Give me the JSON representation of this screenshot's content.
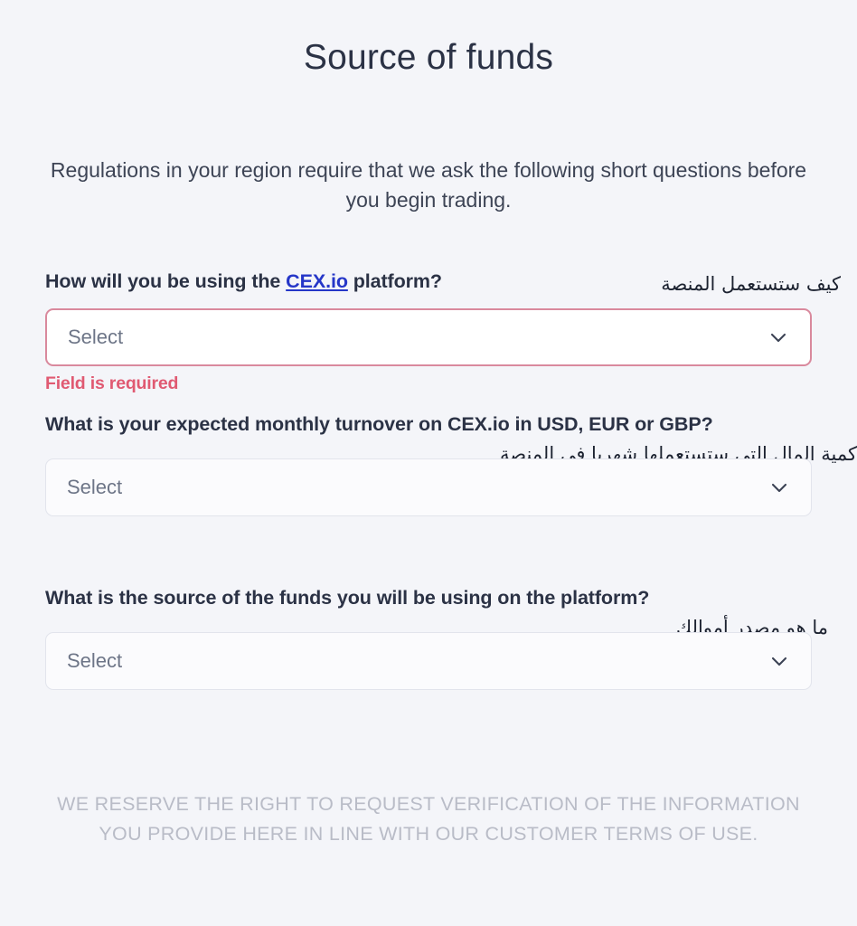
{
  "page": {
    "title": "Source of funds",
    "intro": "Regulations in your region require that we ask the following short questions before you begin trading.",
    "disclaimer": "WE RESERVE THE RIGHT TO REQUEST VERIFICATION OF THE INFORMATION YOU PROVIDE HERE IN LINE WITH OUR CUSTOMER TERMS OF USE.",
    "background_color": "#f4f5f9",
    "title_color": "#2b3245",
    "error_color": "#e05a72",
    "link_color": "#2536c8"
  },
  "questions": [
    {
      "label_before_link": "How will you be using the ",
      "link_text": "CEX.io",
      "label_after_link": " platform?",
      "annotation": "كيف ستستعمل المنصة",
      "select": {
        "value": "Select",
        "placeholder": "Select",
        "state": "error",
        "chevron_icon": "chevron-down-icon"
      },
      "error": "Field is required"
    },
    {
      "label": "What is your expected monthly turnover on CEX.io in USD, EUR or GBP?",
      "annotation": "كمية المال التي ستستعملها شهريا في المنصة",
      "select": {
        "value": "Select",
        "placeholder": "Select",
        "state": "default",
        "chevron_icon": "chevron-down-icon"
      }
    },
    {
      "label": "What is the source of the funds you will be using on the platform?",
      "annotation": "ما هو مصدر أموالك",
      "select": {
        "value": "Select",
        "placeholder": "Select",
        "state": "default",
        "chevron_icon": "chevron-down-icon"
      }
    }
  ]
}
